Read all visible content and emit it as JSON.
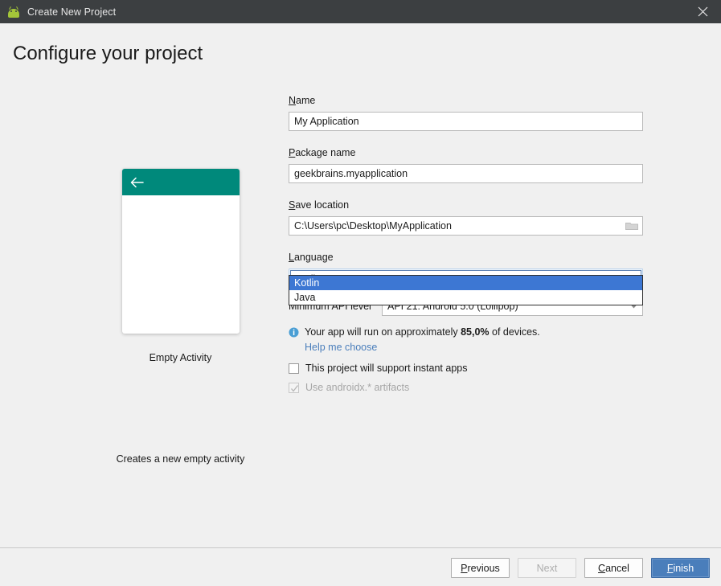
{
  "window": {
    "title": "Create New Project",
    "icon": "android-icon",
    "close_label": "Close"
  },
  "page": {
    "heading": "Configure your project"
  },
  "preview": {
    "template_name": "Empty Activity",
    "description": "Creates a new empty activity",
    "appbar_icon": "back-arrow-icon",
    "appbar_color": "#00897b"
  },
  "form": {
    "name": {
      "label": "Name",
      "mnemonic": "N",
      "rest": "ame",
      "value": "My Application"
    },
    "package_name": {
      "label": "Package name",
      "mnemonic": "P",
      "rest": "ackage name",
      "value": "geekbrains.myapplication"
    },
    "save_location": {
      "label": "Save location",
      "mnemonic": "S",
      "rest": "ave location",
      "value": "C:\\Users\\pc\\Desktop\\MyApplication",
      "browse_icon": "folder-icon"
    },
    "language": {
      "label": "Language",
      "mnemonic": "L",
      "rest": "anguage",
      "value": "Kotlin",
      "expanded": true,
      "options": [
        "Kotlin",
        "Java"
      ],
      "selected_index": 0,
      "highlight_color": "#3d77d3"
    },
    "min_api": {
      "label": "Minimum API level",
      "value": "API 21: Android 5.0 (Lollipop)"
    },
    "device_info": {
      "icon": "info-icon",
      "prefix": "Your app will run on approximately ",
      "percent": "85,0%",
      "suffix": " of devices.",
      "help_link": "Help me choose",
      "link_color": "#4a7ebb"
    },
    "instant_apps": {
      "label": "This project will support instant apps",
      "checked": false,
      "enabled": true
    },
    "androidx": {
      "label": "Use androidx.* artifacts",
      "checked": true,
      "enabled": false
    }
  },
  "footer": {
    "previous": {
      "mnemonic": "P",
      "rest": "revious",
      "enabled": true
    },
    "next": {
      "label": "Next",
      "enabled": false
    },
    "cancel": {
      "pre": "",
      "mnemonic": "C",
      "rest": "ancel",
      "enabled": true
    },
    "finish": {
      "mnemonic": "F",
      "rest": "inish",
      "enabled": true,
      "primary": true,
      "color": "#4a7ebb"
    }
  }
}
